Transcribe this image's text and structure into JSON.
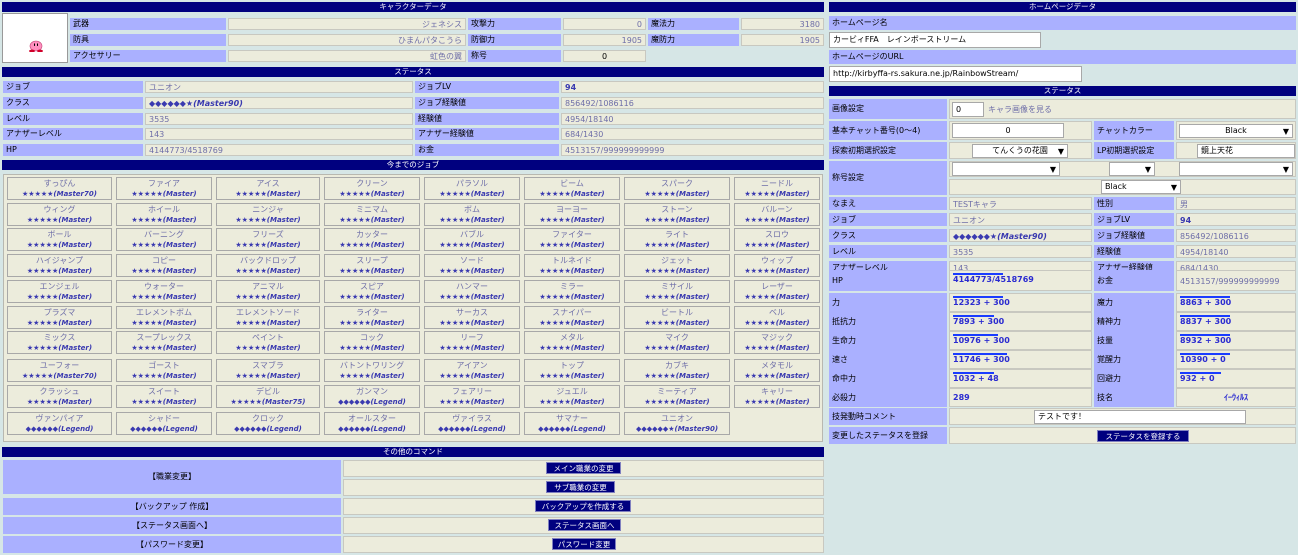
{
  "char": {
    "title": "キャラクターデータ",
    "weapon_label": "武器",
    "weapon": "ジェネシス",
    "armor_label": "防具",
    "armor": "ひまんパタこうら",
    "acc_label": "アクセサリー",
    "acc": "虹色の翼",
    "atk_label": "攻撃力",
    "atk": "0",
    "def_label": "防御力",
    "def": "1905",
    "title_label": "称号",
    "title_val": "0",
    "matk_label": "魔法力",
    "matk": "3180",
    "mdef_label": "魔防力",
    "mdef": "1905"
  },
  "status": {
    "title": "ステータス",
    "job_label": "ジョブ",
    "job": "ユニオン",
    "joblv_label": "ジョブLV",
    "joblv": "94",
    "class_label": "クラス",
    "class": "◆◆◆◆◆◆★(Master90)",
    "jobexp_label": "ジョブ経験値",
    "jobexp": "856492/1086116",
    "level_label": "レベル",
    "level": "3535",
    "exp_label": "経験値",
    "exp": "4954/18140",
    "alevel_label": "アナザーレベル",
    "alevel": "143",
    "aexp_label": "アナザー経験値",
    "aexp": "684/1430",
    "hp_label": "HP",
    "hp": "4144773/4518769",
    "money_label": "お金",
    "money": "4513157/999999999999"
  },
  "jobs_title": "今までのジョブ",
  "jobs": [
    [
      "すっぴん",
      "★★★★★(Master70)"
    ],
    [
      "ファイア",
      "★★★★★(Master)"
    ],
    [
      "アイス",
      "★★★★★(Master)"
    ],
    [
      "クリーン",
      "★★★★★(Master)"
    ],
    [
      "パラソル",
      "★★★★★(Master)"
    ],
    [
      "ビーム",
      "★★★★★(Master)"
    ],
    [
      "スパーク",
      "★★★★★(Master)"
    ],
    [
      "ニードル",
      "★★★★★(Master)"
    ],
    [
      "ウィング",
      "★★★★★(Master)"
    ],
    [
      "ホイール",
      "★★★★★(Master)"
    ],
    [
      "ニンジャ",
      "★★★★★(Master)"
    ],
    [
      "ミニマム",
      "★★★★★(Master)"
    ],
    [
      "ボム",
      "★★★★★(Master)"
    ],
    [
      "ヨーヨー",
      "★★★★★(Master)"
    ],
    [
      "ストーン",
      "★★★★★(Master)"
    ],
    [
      "バルーン",
      "★★★★★(Master)"
    ],
    [
      "ボール",
      "★★★★★(Master)"
    ],
    [
      "バーニング",
      "★★★★★(Master)"
    ],
    [
      "フリーズ",
      "★★★★★(Master)"
    ],
    [
      "カッター",
      "★★★★★(Master)"
    ],
    [
      "バブル",
      "★★★★★(Master)"
    ],
    [
      "ファイター",
      "★★★★★(Master)"
    ],
    [
      "ライト",
      "★★★★★(Master)"
    ],
    [
      "スロウ",
      "★★★★★(Master)"
    ],
    [
      "ハイジャンプ",
      "★★★★★(Master)"
    ],
    [
      "コピー",
      "★★★★★(Master)"
    ],
    [
      "バックドロップ",
      "★★★★★(Master)"
    ],
    [
      "スリープ",
      "★★★★★(Master)"
    ],
    [
      "ソード",
      "★★★★★(Master)"
    ],
    [
      "トルネイド",
      "★★★★★(Master)"
    ],
    [
      "ジェット",
      "★★★★★(Master)"
    ],
    [
      "ウィップ",
      "★★★★★(Master)"
    ],
    [
      "エンジェル",
      "★★★★★(Master)"
    ],
    [
      "ウォーター",
      "★★★★★(Master)"
    ],
    [
      "アニマル",
      "★★★★★(Master)"
    ],
    [
      "スピア",
      "★★★★★(Master)"
    ],
    [
      "ハンマー",
      "★★★★★(Master)"
    ],
    [
      "ミラー",
      "★★★★★(Master)"
    ],
    [
      "ミサイル",
      "★★★★★(Master)"
    ],
    [
      "レーザー",
      "★★★★★(Master)"
    ],
    [
      "プラズマ",
      "★★★★★(Master)"
    ],
    [
      "エレメントボム",
      "★★★★★(Master)"
    ],
    [
      "エレメントソード",
      "★★★★★(Master)"
    ],
    [
      "ライター",
      "★★★★★(Master)"
    ],
    [
      "サーカス",
      "★★★★★(Master)"
    ],
    [
      "スナイパー",
      "★★★★★(Master)"
    ],
    [
      "ビートル",
      "★★★★★(Master)"
    ],
    [
      "ベル",
      "★★★★★(Master)"
    ],
    [
      "ミックス",
      "★★★★★(Master)"
    ],
    [
      "スープレックス",
      "★★★★★(Master)"
    ],
    [
      "ペイント",
      "★★★★★(Master)"
    ],
    [
      "コック",
      "★★★★★(Master)"
    ],
    [
      "リーフ",
      "★★★★★(Master)"
    ],
    [
      "メタル",
      "★★★★★(Master)"
    ],
    [
      "マイク",
      "★★★★★(Master)"
    ],
    [
      "マジック",
      "★★★★★(Master)"
    ],
    [
      "ユーフォー",
      "★★★★★(Master70)"
    ],
    [
      "ゴースト",
      "★★★★★(Master)"
    ],
    [
      "スマブラ",
      "★★★★★(Master)"
    ],
    [
      "バトントワリング",
      "★★★★★(Master)"
    ],
    [
      "アイアン",
      "★★★★★(Master)"
    ],
    [
      "トップ",
      "★★★★★(Master)"
    ],
    [
      "カブキ",
      "★★★★★(Master)"
    ],
    [
      "メタモル",
      "★★★★★(Master)"
    ],
    [
      "クラッシュ",
      "★★★★★(Master)"
    ],
    [
      "スイート",
      "★★★★★(Master)"
    ],
    [
      "デビル",
      "★★★★★(Master75)"
    ],
    [
      "ガンマン",
      "◆◆◆◆◆◆(Legend)"
    ],
    [
      "フェアリー",
      "★★★★★(Master)"
    ],
    [
      "ジュエル",
      "★★★★★(Master)"
    ],
    [
      "ミーティア",
      "★★★★★(Master)"
    ],
    [
      "キャリー",
      "★★★★★(Master)"
    ],
    [
      "ヴァンパイア",
      "◆◆◆◆◆◆(Legend)"
    ],
    [
      "シャドー",
      "◆◆◆◆◆◆(Legend)"
    ],
    [
      "クロック",
      "◆◆◆◆◆◆(Legend)"
    ],
    [
      "オールスター",
      "◆◆◆◆◆◆(Legend)"
    ],
    [
      "ヴァイラス",
      "◆◆◆◆◆◆(Legend)"
    ],
    [
      "サマナー",
      "◆◆◆◆◆◆(Legend)"
    ],
    [
      "ユニオン",
      "◆◆◆◆◆◆★(Master90)"
    ]
  ],
  "cmd": {
    "title": "その他のコマンド",
    "job_change": "【職業変更】",
    "main_job_btn": "メイン職業の変更",
    "sub_job_btn": "サブ職業の変更",
    "backup": "【バックアップ 作成】",
    "backup_btn": "バックアップを作成する",
    "status_page": "【ステータス画面へ】",
    "status_page_btn": "ステータス画面へ",
    "pw": "【パスワード変更】",
    "pw_btn": "パスワード変更"
  },
  "home": {
    "title": "ホームページデータ",
    "name_label": "ホームページ名",
    "name_value": "カービィFFA　レインボーストリーム",
    "url_label": "ホームページのURL",
    "url_value": "http://kirbyffa-rs.sakura.ne.jp/RainbowStream/"
  },
  "rs": {
    "title": "ステータス",
    "img_label": "画像設定",
    "img_value": "0",
    "img_link": "キャラ画像を見る",
    "chat_label": "基本チャット番号(0〜4)",
    "chat_value": "0",
    "chatcolor_label": "チャットカラー",
    "chatcolor_value": "Black",
    "stage_label": "探索初期選択設定",
    "stage_value": "てんくうの花園",
    "lp_label": "LP初期選択設定",
    "lp_value": "鏡上天花",
    "honor_label": "称号設定",
    "honor_color": "Black",
    "name_label": "なまえ",
    "name": "TESTキャラ",
    "sex_label": "性別",
    "sex": "男",
    "job_label": "ジョブ",
    "job": "ユニオン",
    "joblv_label": "ジョブLV",
    "joblv": "94",
    "class_label": "クラス",
    "class": "◆◆◆◆◆◆★(Master90)",
    "jobexp_label": "ジョブ経験値",
    "jobexp": "856492/1086116",
    "level_label": "レベル",
    "level": "3535",
    "exp_label": "経験値",
    "exp": "4954/18140",
    "alevel_label": "アナザーレベル",
    "alevel": "143",
    "aexp_label": "アナザー経験値",
    "aexp": "684/1430",
    "hp_label": "HP",
    "hp": "4144773/4518769",
    "money_label": "お金",
    "money": "4513157/999999999999",
    "stats": [
      {
        "l": "力",
        "v": "12323 + 300",
        "fill": 0.55,
        "l2": "魔力",
        "v2": "8863 + 300",
        "fill2": 0.55
      },
      {
        "l": "抵抗力",
        "v": "7893 + 300",
        "fill": 0.45,
        "l2": "精神力",
        "v2": "8837 + 300",
        "fill2": 0.55
      },
      {
        "l": "生命力",
        "v": "10976 + 300",
        "fill": 0.5,
        "l2": "技量",
        "v2": "8932 + 300",
        "fill2": 0.55
      },
      {
        "l": "速さ",
        "v": "11746 + 300",
        "fill": 0.6,
        "l2": "覚醒力",
        "v2": "10390 + 0",
        "fill2": 0.55
      },
      {
        "l": "命中力",
        "v": "1032 + 48",
        "fill": 0.45,
        "l2": "回避力",
        "v2": "932 + 0",
        "fill2": 0.45
      },
      {
        "l": "必殺力",
        "v": "289",
        "fill": 0,
        "l2": "技名",
        "v2": "ｲｰｳｨﾙｽ",
        "fill2": 0
      }
    ],
    "comment_label": "技発動時コメント",
    "comment_value": "テストです！",
    "save_label": "変更したステータスを登録",
    "save_btn": "ステータスを登録する"
  }
}
